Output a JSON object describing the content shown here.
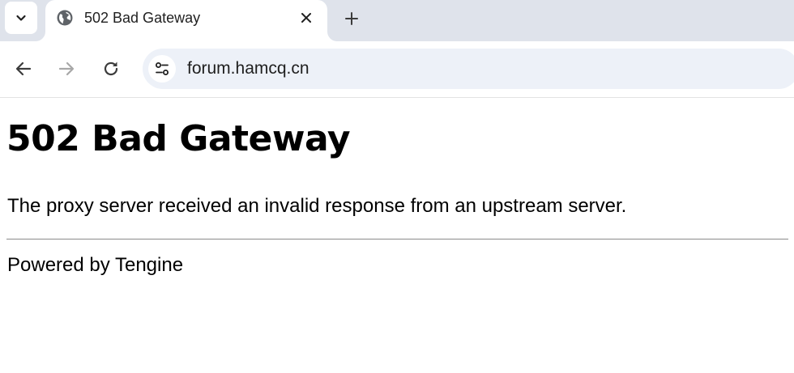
{
  "browser": {
    "tab": {
      "title": "502 Bad Gateway",
      "favicon": "globe-icon"
    },
    "address_bar": {
      "url": "forum.hamcq.cn"
    },
    "icons": {
      "tab_search": "chevron-down-icon",
      "tab_close": "close-icon",
      "new_tab": "plus-icon",
      "back": "arrow-left-icon",
      "forward": "arrow-right-icon",
      "reload": "reload-icon",
      "site_info": "tune-icon"
    }
  },
  "page": {
    "heading": "502 Bad Gateway",
    "message": "The proxy server received an invalid response from an upstream server.",
    "footer": "Powered by Tengine"
  },
  "colors": {
    "tabstrip_bg": "#dfe3eb",
    "omnibox_bg": "#edf1f8",
    "forward_disabled": "#a8a8a8"
  }
}
